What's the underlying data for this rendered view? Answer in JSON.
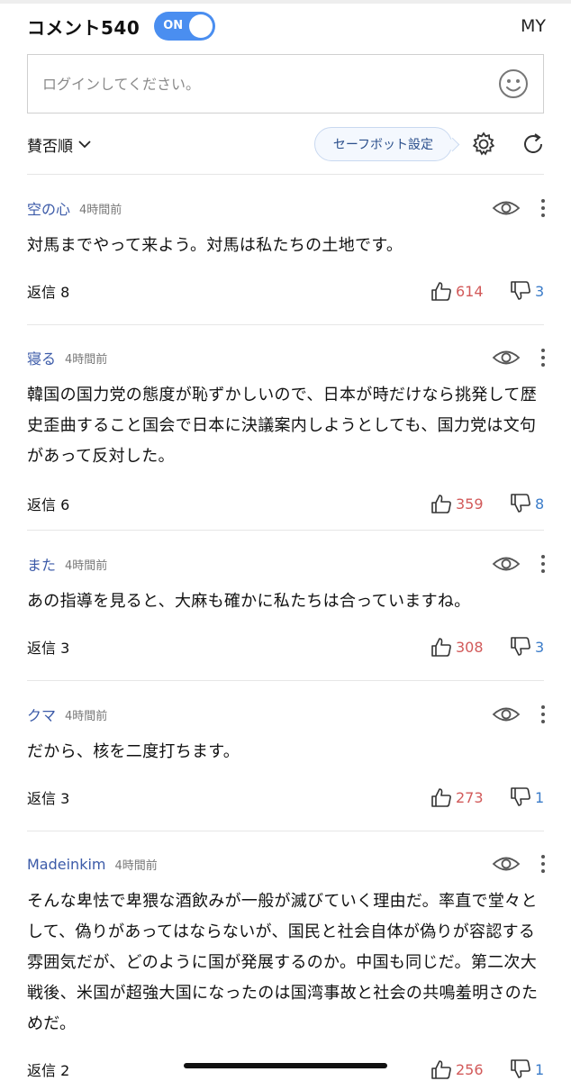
{
  "header": {
    "title": "コメント540",
    "toggle_label": "ON",
    "my_label": "MY"
  },
  "login": {
    "placeholder": "ログインしてください。"
  },
  "toolbar": {
    "sort_label": "賛否順",
    "safebot_label": "セーフボット設定"
  },
  "colors": {
    "toggle_on": "#4a8ef0",
    "username": "#3b5aa8",
    "like": "#d25a5a",
    "dislike": "#3b7cc9"
  },
  "comments": [
    {
      "user": "空の心",
      "time": "4時間前",
      "text": "対馬までやって来よう。対馬は私たちの土地です。",
      "reply": "返信 8",
      "likes": "614",
      "dislikes": "3"
    },
    {
      "user": "寝る",
      "time": "4時間前",
      "text": "韓国の国力党の態度が恥ずかしいので、日本が時だけなら挑発して歴史歪曲すること国会で日本に決議案内しようとしても、国力党は文句があって反対した。",
      "reply": "返信 6",
      "likes": "359",
      "dislikes": "8"
    },
    {
      "user": "また",
      "time": "4時間前",
      "text": "あの指導を見ると、大麻も確かに私たちは合っていますね。",
      "reply": "返信 3",
      "likes": "308",
      "dislikes": "3"
    },
    {
      "user": "クマ",
      "time": "4時間前",
      "text": "だから、核を二度打ちます。",
      "reply": "返信 3",
      "likes": "273",
      "dislikes": "1"
    },
    {
      "user": "Madeinkim",
      "time": "4時間前",
      "text": "そんな卑怯で卑猥な酒飲みが一般が滅びていく理由だ。率直で堂々として、偽りがあってはならないが、国民と社会自体が偽りが容認する雰囲気だが、どのように国が発展するのか。中国も同じだ。第二次大戦後、米国が超強大国になったのは国湾事故と社会の共鳴羞明さのためだ。",
      "reply": "返信 2",
      "likes": "256",
      "dislikes": "1"
    }
  ]
}
